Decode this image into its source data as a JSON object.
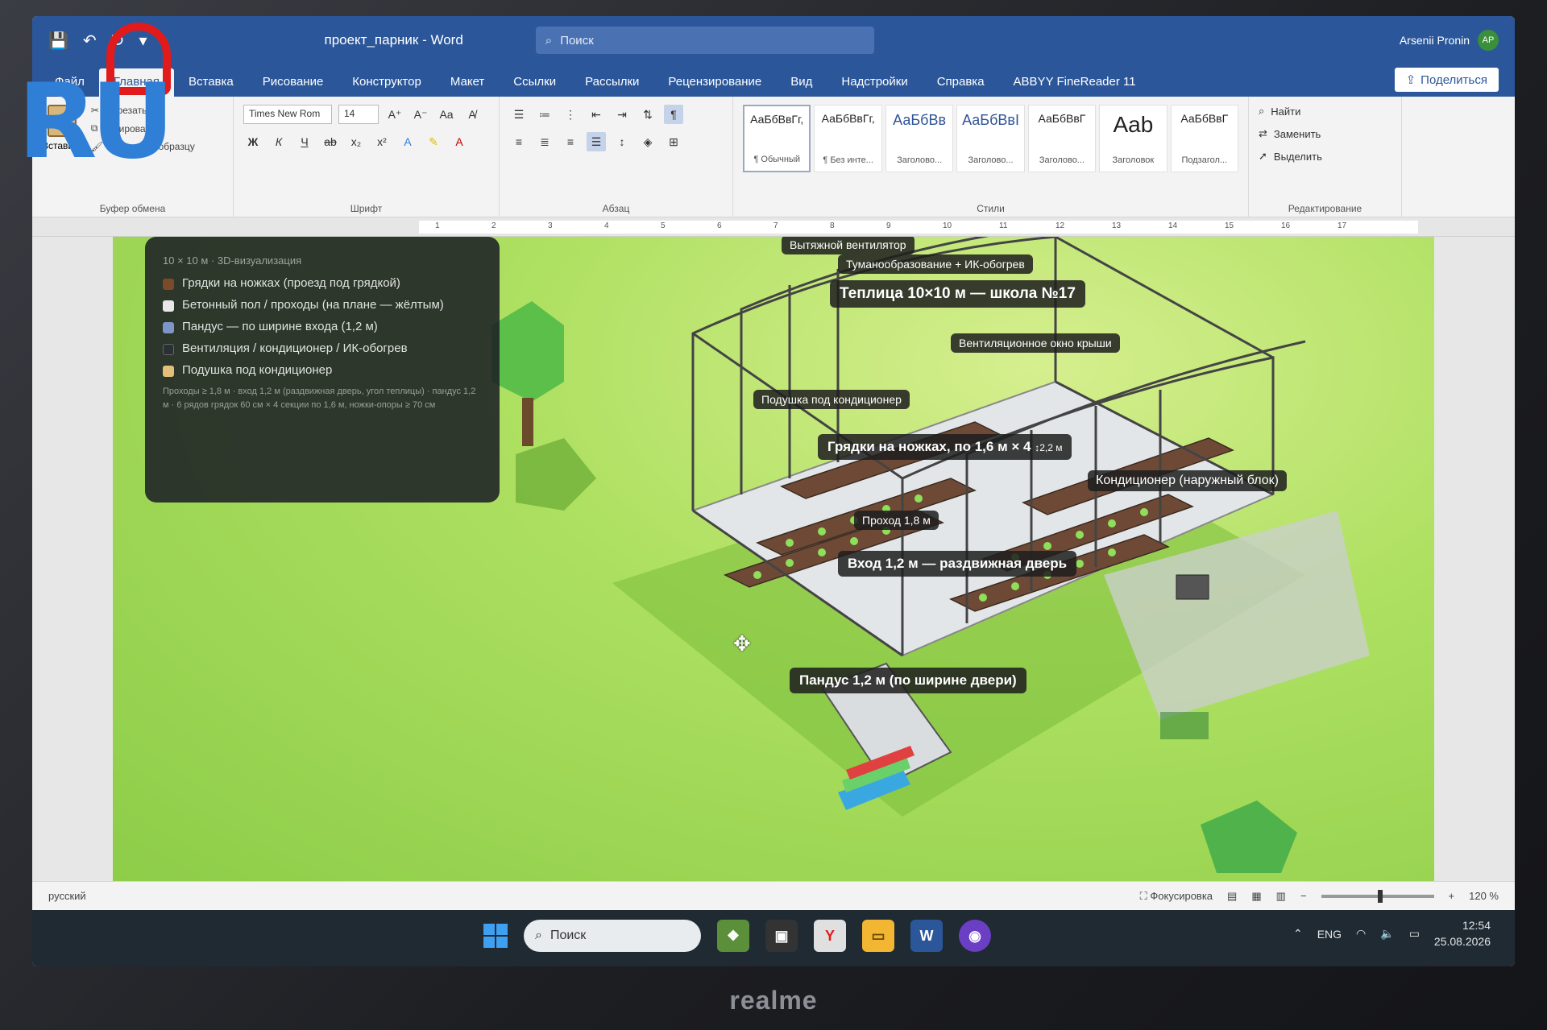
{
  "app": {
    "doc_title": "проект_парник - Word",
    "search_placeholder": "Поиск",
    "user_name": "Arsenii Pronin",
    "user_initials": "AP"
  },
  "tabs": [
    {
      "label": "Файл"
    },
    {
      "label": "Главная"
    },
    {
      "label": "Вставка"
    },
    {
      "label": "Рисование"
    },
    {
      "label": "Конструктор"
    },
    {
      "label": "Макет"
    },
    {
      "label": "Ссылки"
    },
    {
      "label": "Рассылки"
    },
    {
      "label": "Рецензирование"
    },
    {
      "label": "Вид"
    },
    {
      "label": "Надстройки"
    },
    {
      "label": "Справка"
    },
    {
      "label": "ABBYY FineReader 11"
    }
  ],
  "share_label": "Поделиться",
  "ribbon": {
    "clipboard": {
      "label": "Буфер обмена",
      "paste": "Вставить",
      "cut": "Вырезать",
      "copy": "Копировать",
      "format_painter": "Формат по образцу"
    },
    "font": {
      "label": "Шрифт",
      "family": "Times New Rom",
      "size": "14"
    },
    "paragraph": {
      "label": "Абзац"
    },
    "styles": {
      "label": "Стили",
      "items": [
        {
          "sample": "АаБбВвГг,",
          "name": "¶ Обычный"
        },
        {
          "sample": "АаБбВвГг,",
          "name": "¶ Без инте..."
        },
        {
          "sample": "АаБбВв",
          "name": "Заголово..."
        },
        {
          "sample": "АаБбВвІ",
          "name": "Заголово..."
        },
        {
          "sample": "АаБбВвГ",
          "name": "Заголово..."
        },
        {
          "sample": "Aab",
          "name": "Заголовок"
        },
        {
          "sample": "АаБбВвГ",
          "name": "Подзагол..."
        }
      ]
    },
    "editing": {
      "label": "Редактирование",
      "find": "Найти",
      "replace": "Заменить",
      "select": "Выделить"
    }
  },
  "ruler_numbers": [
    "1",
    "2",
    "3",
    "4",
    "5",
    "6",
    "7",
    "8",
    "9",
    "10",
    "11",
    "12",
    "13",
    "14",
    "15",
    "16",
    "17"
  ],
  "legend": {
    "subtitle": "10 × 10 м · 3D-визуализация",
    "items": [
      {
        "label": "Грядки на ножках (проезд под грядкой)",
        "color": "#7a4a2a"
      },
      {
        "label": "Бетонный пол / проходы (на плане — жёлтым)",
        "color": "#e8e8e8"
      },
      {
        "label": "Пандус — по ширине входа (1,2 м)",
        "color": "#7e95c8"
      },
      {
        "label": "Вентиляция / кондиционер / ИК-обогрев",
        "color": "#2b2f36"
      },
      {
        "label": "Подушка под кондиционер",
        "color": "#e3c07a"
      }
    ],
    "note": "Проходы ≥ 1,8 м · вход 1,2 м (раздвижная дверь, угол теплицы) · пандус 1,2 м · 6 рядов грядок 60 см × 4 секции по 1,6 м, ножки-опоры ≥ 70 см"
  },
  "scene_labels": {
    "fan": "Вытяжной вентилятор",
    "fog": "Туманообразование + ИК-обогрев",
    "title": "Теплица 10×10 м — школа №17",
    "roof_vent": "Вентиляционное окно крыши",
    "ac_pad": "Подушка под кондиционер",
    "beds": "Грядки на ножках, по 1,6 м × 4",
    "beds_h": "↕2,2 м",
    "ac_unit": "Кондиционер (наружный блок)",
    "aisle": "Проход 1,8 м",
    "entrance": "Вход 1,2 м — раздвижная дверь",
    "ramp": "Пандус 1,2 м (по ширине двери)"
  },
  "status": {
    "focus": "Фокусировка",
    "zoom": "120 %",
    "lang": "русский"
  },
  "taskbar": {
    "search": "Поиск",
    "lang": "ENG",
    "time": "12:54",
    "date": "25.08.2026"
  },
  "brand": "realme",
  "watermark": "RU",
  "colors": {
    "word_blue": "#2b579a",
    "grass": "#9bd65a",
    "label_bg": "#1e1e1e"
  }
}
